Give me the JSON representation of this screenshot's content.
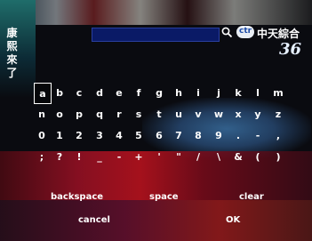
{
  "channel": {
    "vertical_name": "康熙來了",
    "logo_abbrev": "ctr",
    "logo_name": "中天綜合",
    "logo_number": "36"
  },
  "search": {
    "value": "",
    "icon": "search-icon"
  },
  "keyboard": {
    "selected": "a",
    "rows": [
      [
        "a",
        "b",
        "c",
        "d",
        "e",
        "f",
        "g",
        "h",
        "i",
        "j",
        "k",
        "l",
        "m"
      ],
      [
        "n",
        "o",
        "p",
        "q",
        "r",
        "s",
        "t",
        "u",
        "v",
        "w",
        "x",
        "y",
        "z"
      ],
      [
        "0",
        "1",
        "2",
        "3",
        "4",
        "5",
        "6",
        "7",
        "8",
        "9",
        ".",
        "-",
        ","
      ],
      [
        ";",
        "?",
        "!",
        "_",
        "-",
        "+",
        "'",
        "\"",
        "/",
        "\\",
        "&",
        "(",
        ")"
      ]
    ],
    "backspace": "backspace",
    "space": "space",
    "clear": "clear",
    "cancel": "cancel",
    "ok": "OK"
  }
}
